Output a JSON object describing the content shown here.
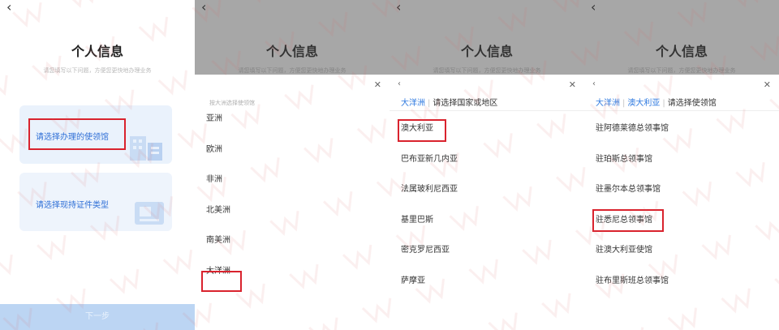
{
  "screen1": {
    "back_icon": "chevron-left-icon",
    "title": "个人信息",
    "subtitle": "请您填写以下问题，方便您更快地办理业务",
    "card_embassy_label": "请选择办理的使领馆",
    "card_document_label": "请选择现持证件类型",
    "next_label": "下一步"
  },
  "screen2": {
    "title": "个人信息",
    "subtitle": "请您填写以下问题，方便您更快地办理业务",
    "sheet_hint": "按大洲选择使领馆",
    "continents": [
      "亚洲",
      "欧洲",
      "非洲",
      "北美洲",
      "南美洲",
      "大洋洲"
    ]
  },
  "screen3": {
    "title": "个人信息",
    "subtitle": "请您填写以下问题，方便您更快地办理业务",
    "crumb_continent": "大洋洲",
    "crumb_prompt": "请选择国家或地区",
    "countries": [
      "澳大利亚",
      "巴布亚新几内亚",
      "法属玻利尼西亚",
      "基里巴斯",
      "密克罗尼西亚",
      "萨摩亚"
    ]
  },
  "screen4": {
    "title": "个人信息",
    "subtitle": "请您填写以下问题，方便您更快地办理业务",
    "crumb_continent": "大洋洲",
    "crumb_country": "澳大利亚",
    "crumb_prompt": "请选择使领馆",
    "consulates": [
      "驻阿德莱德总领事馆",
      "驻珀斯总领事馆",
      "驻墨尔本总领事馆",
      "驻悉尼总领事馆",
      "驻澳大利亚使馆",
      "驻布里斯班总领事馆"
    ]
  },
  "colors": {
    "accent": "#2f7ae0",
    "highlight_box": "#d9232e",
    "overlay": "#a7a7a7",
    "button": "#bcd5f3"
  }
}
